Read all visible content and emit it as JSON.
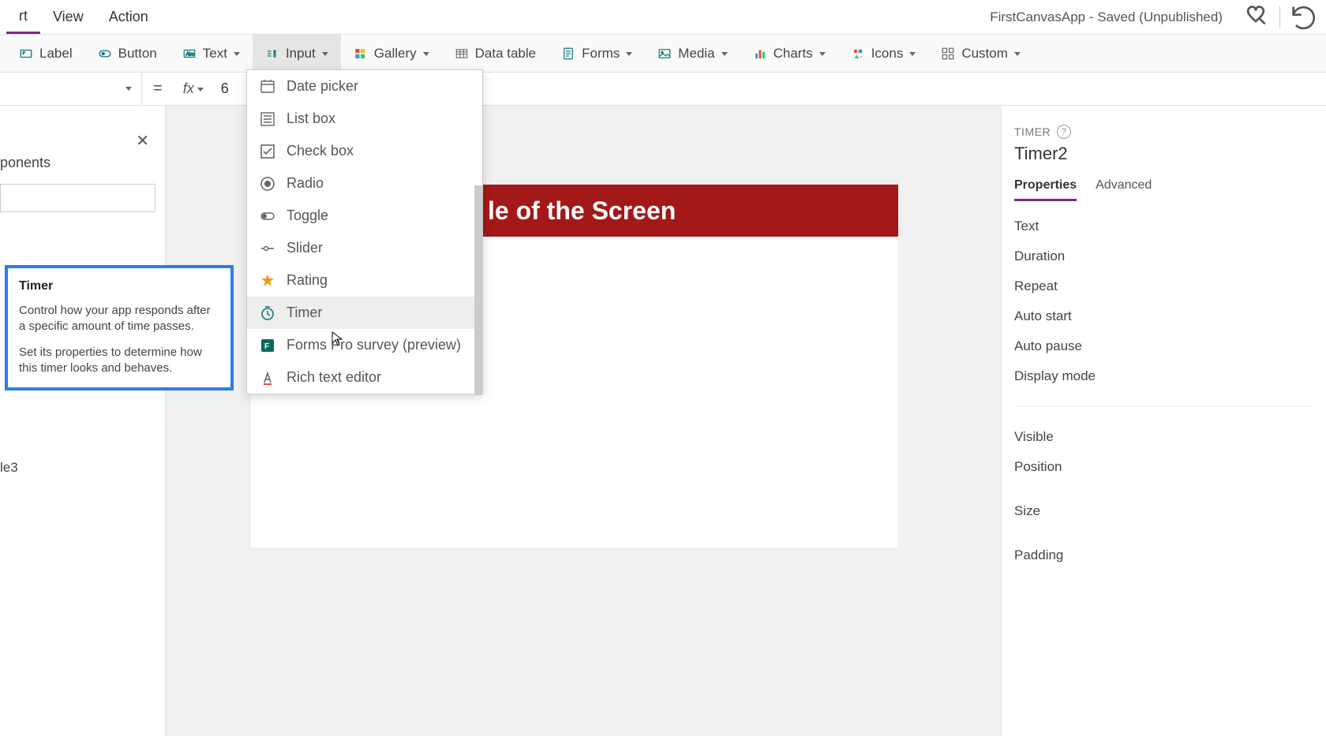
{
  "header": {
    "tabs": [
      "rt",
      "View",
      "Action"
    ],
    "active_tab": "rt",
    "title": "FirstCanvasApp - Saved (Unpublished)"
  },
  "ribbon": {
    "label": "Label",
    "button": "Button",
    "text": "Text",
    "input": "Input",
    "gallery": "Gallery",
    "data_table": "Data table",
    "forms": "Forms",
    "media": "Media",
    "charts": "Charts",
    "icons": "Icons",
    "custom": "Custom"
  },
  "formula": {
    "fx": "fx",
    "value_partial": "6"
  },
  "tree": {
    "header": "ponents",
    "leaf": "le3"
  },
  "callout": {
    "title": "Timer",
    "p1": "Control how your app responds after a specific amount of time passes.",
    "p2": "Set its properties to determine how this timer looks and behaves."
  },
  "dropdown": {
    "items": [
      {
        "label": "Date picker",
        "icon": "date-picker-icon"
      },
      {
        "label": "List box",
        "icon": "list-box-icon"
      },
      {
        "label": "Check box",
        "icon": "check-box-icon"
      },
      {
        "label": "Radio",
        "icon": "radio-icon"
      },
      {
        "label": "Toggle",
        "icon": "toggle-icon"
      },
      {
        "label": "Slider",
        "icon": "slider-icon"
      },
      {
        "label": "Rating",
        "icon": "rating-icon"
      },
      {
        "label": "Timer",
        "icon": "timer-icon"
      },
      {
        "label": "Forms Pro survey (preview)",
        "icon": "forms-pro-icon"
      },
      {
        "label": "Rich text editor",
        "icon": "rich-text-icon"
      }
    ],
    "hover_index": 7
  },
  "canvas": {
    "title_text": "le of the Screen"
  },
  "props": {
    "kind": "TIMER",
    "name": "Timer2",
    "tabs": [
      "Properties",
      "Advanced"
    ],
    "active_tab": "Properties",
    "rows1": [
      "Text",
      "Duration",
      "Repeat",
      "Auto start",
      "Auto pause",
      "Display mode"
    ],
    "rows2": [
      "Visible",
      "Position",
      "Size",
      "Padding"
    ]
  }
}
